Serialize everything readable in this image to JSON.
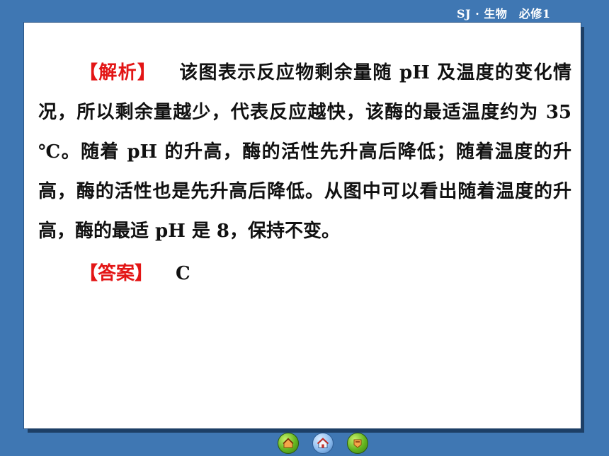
{
  "header": {
    "course_label": "SJ · 生物　必修1"
  },
  "content": {
    "analysis_tag": "【解析】",
    "analysis_text": "该图表示反应物剩余量随 pH 及温度的变化情况，所以剩余量越少，代表反应越快，该酶的最适温度约为 35 ℃。随着 pH 的升高，酶的活性先升高后降低；随着温度的升高，酶的活性也是先升高后降低。从图中可以看出随着温度的升高，酶的最适 pH 是 8，保持不变。",
    "answer_tag": "【答案】",
    "answer_text": "C"
  },
  "nav": {
    "buttons": [
      "prev-icon",
      "home-icon",
      "next-icon"
    ]
  }
}
